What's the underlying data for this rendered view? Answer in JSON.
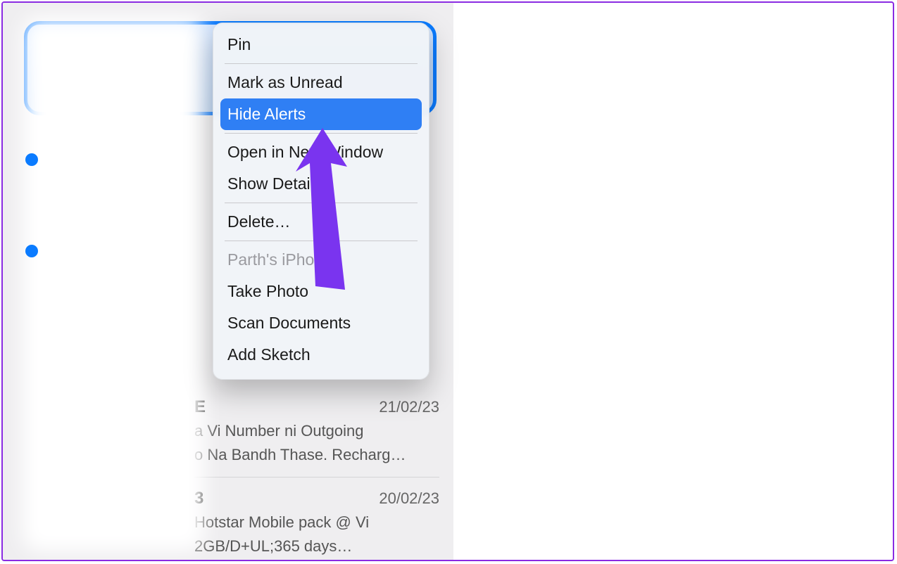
{
  "context_menu": {
    "pin": "Pin",
    "mark_unread": "Mark as Unread",
    "hide_alerts": "Hide Alerts",
    "open_window": "Open in New Window",
    "show_details": "Show Details",
    "delete": "Delete…",
    "device_header": "Parth's iPhone",
    "take_photo": "Take Photo",
    "scan_docs": "Scan Documents",
    "add_sketch": "Add Sketch"
  },
  "rows": {
    "e": {
      "sender": "E",
      "time": "21/02/23",
      "preview1": "a Vi Number ni Outgoing",
      "preview2": "o Na Bandh Thase. Recharg…"
    },
    "f": {
      "sender": "3",
      "time": "20/02/23",
      "preview1": "Hotstar Mobile pack @ Vi",
      "preview2": "2GB/D+UL;365 days…"
    }
  },
  "colors": {
    "accent": "#0a7bff",
    "annotation": "#7a34ef"
  }
}
